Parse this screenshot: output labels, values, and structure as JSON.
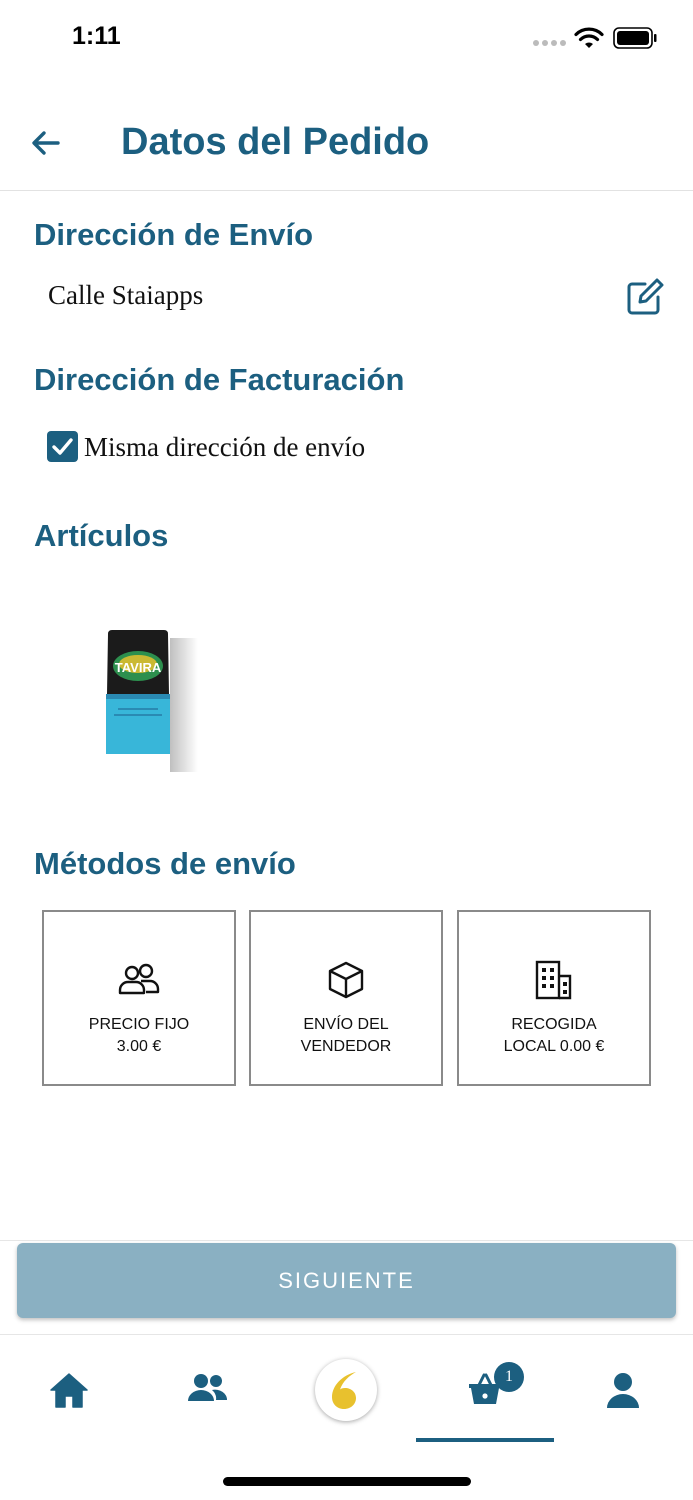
{
  "status_bar": {
    "time": "1:11"
  },
  "header": {
    "title": "Datos del Pedido",
    "back_icon": "arrow-left-icon"
  },
  "shipping_address": {
    "title": "Dirección de Envío",
    "value": "Calle Staiapps",
    "edit_icon": "edit-icon"
  },
  "billing_address": {
    "title": "Dirección de Facturación",
    "same_as_shipping_label": "Misma dirección de envío",
    "same_as_shipping_checked": true
  },
  "articles": {
    "title": "Artículos",
    "items": [
      {
        "image_brand": "TAVIRA"
      }
    ]
  },
  "shipping_methods": {
    "title": "Métodos de envío",
    "options": [
      {
        "label": "PRECIO FIJO\n3.00 €",
        "icon": "users-icon"
      },
      {
        "label": "ENVÍO DEL\nVENDEDOR",
        "icon": "box-icon"
      },
      {
        "label": "RECOGIDA\nLOCAL 0.00 €",
        "icon": "building-icon"
      }
    ]
  },
  "next_button": {
    "label": "SIGUIENTE"
  },
  "bottom_nav": {
    "items": [
      "home-icon",
      "users-icon",
      "logo-icon",
      "basket-icon",
      "profile-icon"
    ],
    "cart_count": "1",
    "active_index": 3
  },
  "colors": {
    "primary": "#1c5f80",
    "button_disabled": "#8ab0c2",
    "logo_yellow": "#e8c12e"
  }
}
